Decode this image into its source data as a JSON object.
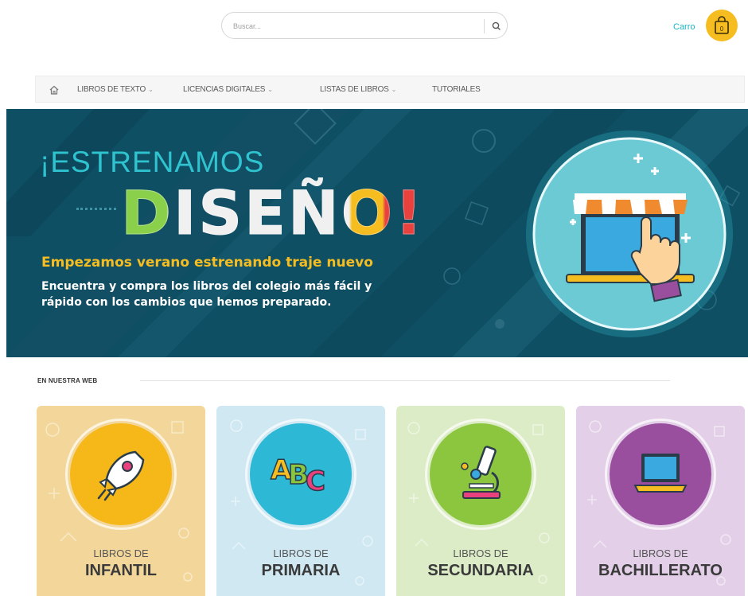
{
  "header": {
    "search_placeholder": "Buscar...",
    "cart_label": "Carro",
    "cart_count": "0"
  },
  "nav": {
    "items": [
      {
        "label": "LIBROS DE TEXTO",
        "has_dropdown": true
      },
      {
        "label": "LICENCIAS DIGITALES",
        "has_dropdown": true
      },
      {
        "label": "LISTAS DE LIBROS",
        "has_dropdown": true
      },
      {
        "label": "TUTORIALES",
        "has_dropdown": false
      }
    ],
    "chevron": "⌄"
  },
  "hero": {
    "line1": "¡ESTRENAMOS",
    "line2": "DISEÑO!",
    "subtitle": "Empezamos verano estrenando traje nuevo",
    "text": "Encuentra y compra los libros del colegio más fácil y rápido con los cambios que hemos preparado."
  },
  "section": {
    "title": "EN NUESTRA WEB"
  },
  "cards": [
    {
      "line1": "LIBROS DE",
      "line2": "INFANTIL",
      "icon": "rocket-icon",
      "bg": "#f3d79a",
      "circle": "#f6b818"
    },
    {
      "line1": "LIBROS DE",
      "line2": "PRIMARIA",
      "icon": "abc-icon",
      "bg": "#cfe8f2",
      "circle": "#2db8d6"
    },
    {
      "line1": "LIBROS DE",
      "line2": "SECUNDARIA",
      "icon": "microscope-icon",
      "bg": "#dcecc6",
      "circle": "#8cc63f"
    },
    {
      "line1": "LIBROS DE",
      "line2": "BACHILLERATO",
      "icon": "laptop-icon",
      "bg": "#e3d0e8",
      "circle": "#9a4f9e"
    }
  ],
  "colors": {
    "brand_teal": "#1ab3c4",
    "brand_yellow": "#f6bd20",
    "hero_bg": "#0f4f63"
  }
}
